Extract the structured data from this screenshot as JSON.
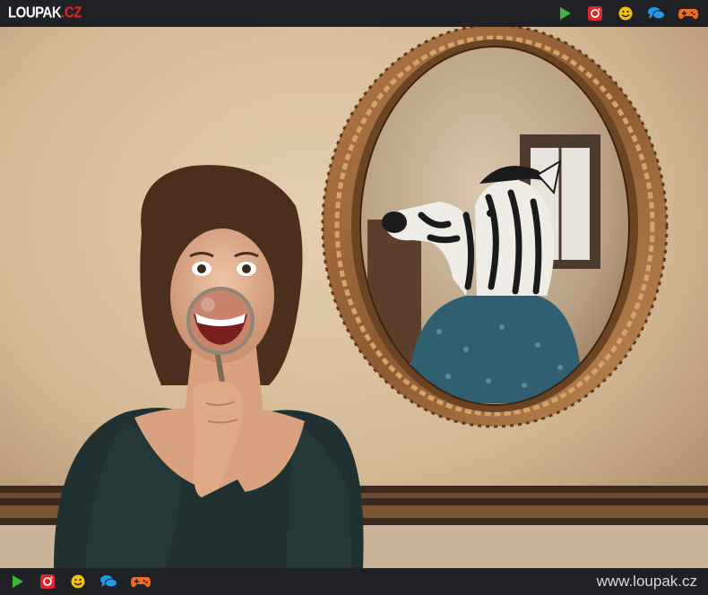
{
  "header": {
    "logo_main": "LOUPAK",
    "logo_suffix": ".CZ",
    "icons": [
      "play-icon",
      "instagram-icon",
      "smiley-icon",
      "chat-icon",
      "gamepad-icon"
    ]
  },
  "footer": {
    "url": "www.loupak.cz",
    "icons": [
      "play-icon",
      "instagram-icon",
      "smiley-icon",
      "chat-icon",
      "gamepad-icon"
    ]
  },
  "colors": {
    "bar_bg": "#1f2124",
    "play": "#3fb33a",
    "instagram": "#e5232a",
    "smiley": "#f4c20d",
    "chat": "#1e9be9",
    "gamepad": "#f26a1b",
    "logo_accent": "#e5232a"
  }
}
